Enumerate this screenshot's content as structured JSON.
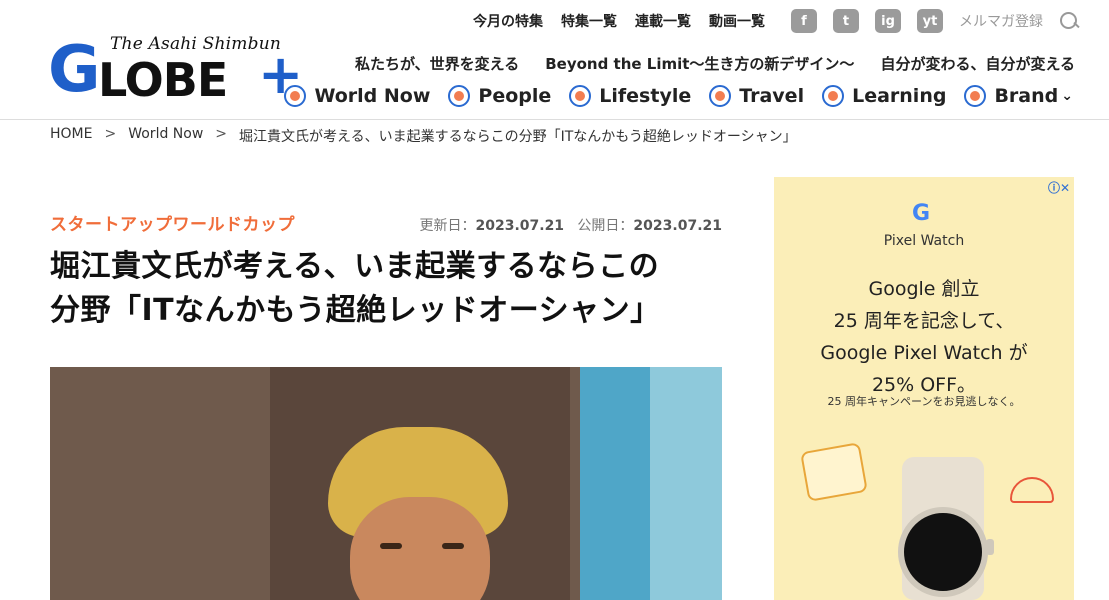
{
  "logo": {
    "tagline": "The Asahi Shimbun",
    "g": "G",
    "lobe": "LOBE",
    "plus": "+"
  },
  "topnav": {
    "links": [
      "今月の特集",
      "特集一覧",
      "連載一覧",
      "動画一覧"
    ],
    "social": [
      "f",
      "t",
      "ig",
      "yt"
    ],
    "newsletter": "メルマガ登録"
  },
  "midnav": [
    "私たちが、世界を変える",
    "Beyond the Limit〜生き方の新デザイン〜",
    "自分が変わる、自分が変える"
  ],
  "categories": [
    "World Now",
    "People",
    "Lifestyle",
    "Travel",
    "Learning",
    "Brand"
  ],
  "breadcrumb": {
    "home": "HOME",
    "section": "World Now",
    "current": "堀江貴文氏が考える、いま起業するならこの分野「ITなんかもう超絶レッドオーシャン」",
    "sep": ">"
  },
  "article": {
    "category": "スタートアップワールドカップ",
    "updated_label": "更新日：",
    "updated": "2023.07.21",
    "published_label": "公開日：",
    "published": "2023.07.21",
    "title_line1": "堀江貴文氏が考える、いま起業するならこの",
    "title_line2": "分野「ITなんかもう超絶レッドオーシャン」"
  },
  "ad": {
    "choices": "ⓘ✕",
    "brand_logo": "G",
    "product": "Pixel Watch",
    "headline_line1": "Google 創立",
    "headline_line2": "25 周年を記念して、",
    "headline_line3": "Google Pixel Watch が",
    "headline_line4": "25% OFF。",
    "sub": "25 周年キャンペーンをお見逃しなく。"
  },
  "colors": {
    "accent": "#1f5fc9",
    "category": "#f06d3a",
    "ad_bg": "#fbeeb8"
  }
}
